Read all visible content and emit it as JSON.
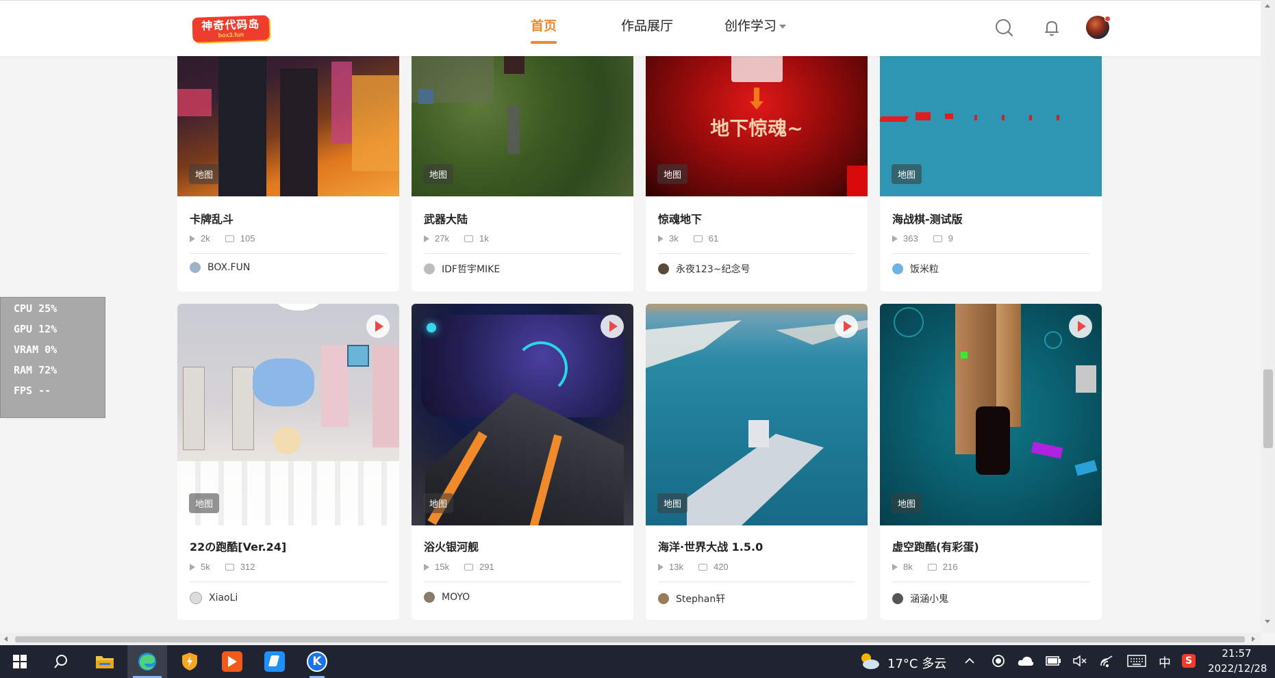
{
  "header": {
    "logo_text": "神奇代码岛",
    "logo_sub": "box3.fun",
    "nav": [
      {
        "label": "首页",
        "active": true
      },
      {
        "label": "作品展厅",
        "active": false
      },
      {
        "label": "创作学习",
        "active": false
      }
    ]
  },
  "cards": [
    {
      "title": "卡牌乱斗",
      "tag": "地图",
      "plays": "2k",
      "comments": "105",
      "author": "BOX.FUN"
    },
    {
      "title": "武器大陆",
      "tag": "地图",
      "plays": "27k",
      "comments": "1k",
      "author": "IDF哲宇MIKE"
    },
    {
      "title": "惊魂地下",
      "tag": "地图",
      "plays": "3k",
      "comments": "61",
      "author": "永夜123~纪念号",
      "thumb_text": "地下惊魂~"
    },
    {
      "title": "海战棋-测试版",
      "tag": "地图",
      "plays": "363",
      "comments": "9",
      "author": "饭米粒"
    },
    {
      "title": "22の跑酷[Ver.24]",
      "tag": "地图",
      "plays": "5k",
      "comments": "312",
      "author": "XiaoLi"
    },
    {
      "title": "浴火银河舰",
      "tag": "地图",
      "plays": "15k",
      "comments": "291",
      "author": "MOYO"
    },
    {
      "title": "海洋·世界大战 1.5.0",
      "tag": "地图",
      "plays": "13k",
      "comments": "420",
      "author": "Stephan轩"
    },
    {
      "title": "虚空跑酷(有彩蛋)",
      "tag": "地图",
      "plays": "8k",
      "comments": "216",
      "author": "涵涵小鬼"
    }
  ],
  "perf_overlay": {
    "cpu": "CPU  25%",
    "gpu": "GPU  12%",
    "vram": "VRAM  0%",
    "ram": "RAM  72%",
    "fps": "FPS --"
  },
  "taskbar": {
    "weather": "17°C  多云",
    "ime": "中",
    "time": "21:57",
    "date": "2022/12/28"
  },
  "colors": {
    "accent": "#f0872b",
    "logo_red": "#ef3d2d",
    "taskbar_bg": "#1f2430"
  }
}
